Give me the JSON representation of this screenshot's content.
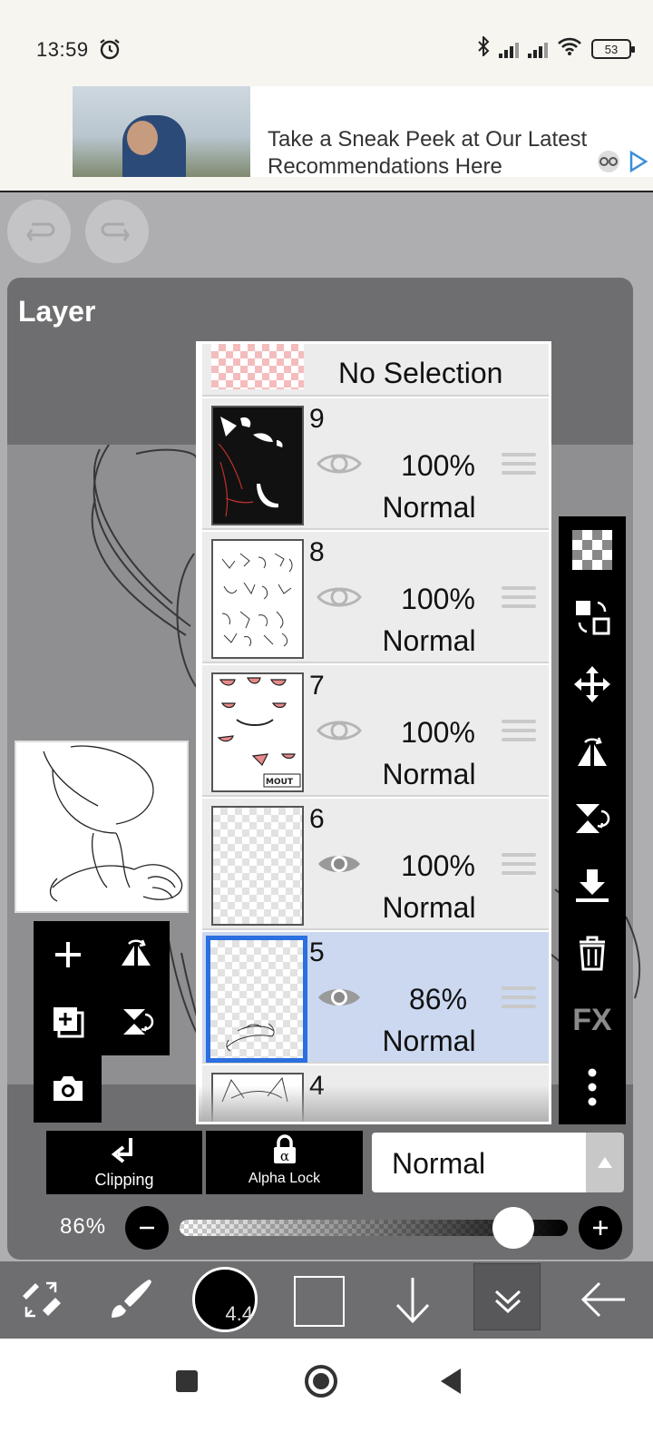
{
  "status_bar": {
    "time": "13:59",
    "battery": "53",
    "icons": [
      "alarm-icon",
      "bluetooth-icon",
      "signal-icon",
      "signal-icon",
      "wifi-icon",
      "battery-icon"
    ]
  },
  "ad": {
    "line1": "Take a Sneak Peek at Our Latest",
    "line2": "Recommendations Here"
  },
  "panel": {
    "title": "Layer"
  },
  "layers": {
    "no_selection": "No Selection",
    "items": [
      {
        "number": "9",
        "opacity": "100%",
        "blend": "Normal",
        "visible": false,
        "selected": false,
        "thumb": "dark"
      },
      {
        "number": "8",
        "opacity": "100%",
        "blend": "Normal",
        "visible": false,
        "selected": false,
        "thumb": "white"
      },
      {
        "number": "7",
        "opacity": "100%",
        "blend": "Normal",
        "visible": false,
        "selected": false,
        "thumb": "white"
      },
      {
        "number": "6",
        "opacity": "100%",
        "blend": "Normal",
        "visible": true,
        "selected": false,
        "thumb": "transparent"
      },
      {
        "number": "5",
        "opacity": "86%",
        "blend": "Normal",
        "visible": true,
        "selected": true,
        "thumb": "transparent"
      },
      {
        "number": "4",
        "opacity": "",
        "blend": "",
        "visible": true,
        "selected": false,
        "thumb": "white"
      }
    ]
  },
  "layer_controls": {
    "clipping_label": "Clipping",
    "alpha_lock_label": "Alpha Lock",
    "alpha_lock_glyph": "α",
    "blend_mode": "Normal",
    "opacity_label": "86%",
    "opacity_value": 0.86
  },
  "right_toolbar": {
    "fx_label": "FX"
  },
  "bottom_toolbar": {
    "brush_size": "4.4"
  },
  "colors": {
    "selected_layer_bg": "#cbd8f0",
    "selected_layer_border": "#2b6fe0",
    "panel_bg": "#6e6e70"
  }
}
